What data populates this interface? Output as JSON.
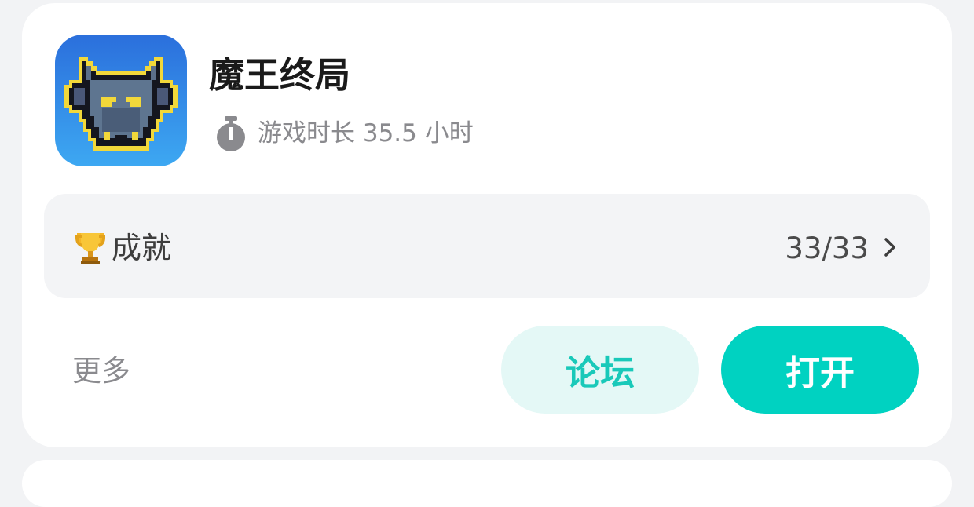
{
  "game": {
    "title": "魔王终局",
    "icon": "demon-wolf-pixel-icon",
    "playtime_label": "游戏时长 35.5 小时"
  },
  "achievement": {
    "icon": "trophy-icon",
    "label": "成就",
    "count": "33/33"
  },
  "actions": {
    "more_label": "更多",
    "forum_label": "论坛",
    "open_label": "打开"
  },
  "colors": {
    "accent": "#00d2c1",
    "forum_text": "#19c9b9",
    "forum_bg": "#e4f8f6",
    "icon_bg_top": "#2f7ee0",
    "icon_bg_bottom": "#3fa4f0"
  }
}
